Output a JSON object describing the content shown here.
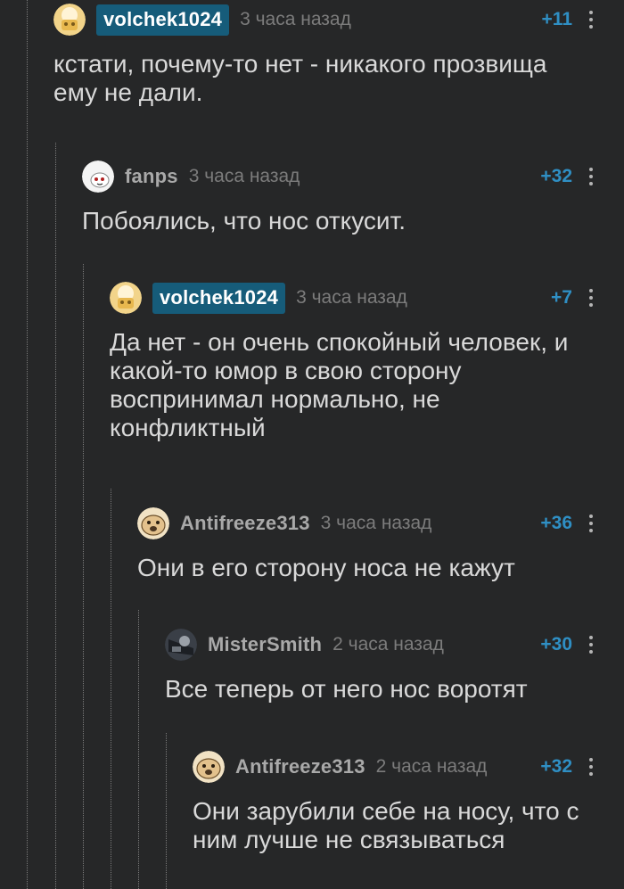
{
  "comments": [
    {
      "user": "volchek1024",
      "time": "3 часа назад",
      "rating": "+11",
      "text": "кстати, почему-то нет - никакого прозвища ему не дали."
    },
    {
      "user": "fanps",
      "time": "3 часа назад",
      "rating": "+32",
      "text": "Побоялись, что нос откусит."
    },
    {
      "user": "volchek1024",
      "time": "3 часа назад",
      "rating": "+7",
      "text": "Да нет - он очень спокойный человек, и какой-то юмор в свою сторону воспринимал нормально, не конфликтный"
    },
    {
      "user": "Antifreeze313",
      "time": "3 часа назад",
      "rating": "+36",
      "text": "Они в его сторону носа не кажут"
    },
    {
      "user": "MisterSmith",
      "time": "2 часа назад",
      "rating": "+30",
      "text": "Все теперь от него нос воротят"
    },
    {
      "user": "Antifreeze313",
      "time": "2 часа назад",
      "rating": "+32",
      "text": "Они зарубили себе на носу, что с ним лучше не связываться"
    }
  ],
  "colors": {
    "background": "#262728",
    "author_badge": "#165c7a",
    "rating": "#2f8fc4"
  },
  "icons": [
    "cat-avatar-icon",
    "ghost-avatar-icon",
    "pug-avatar-icon",
    "dark-avatar-icon",
    "more-vertical-icon"
  ]
}
